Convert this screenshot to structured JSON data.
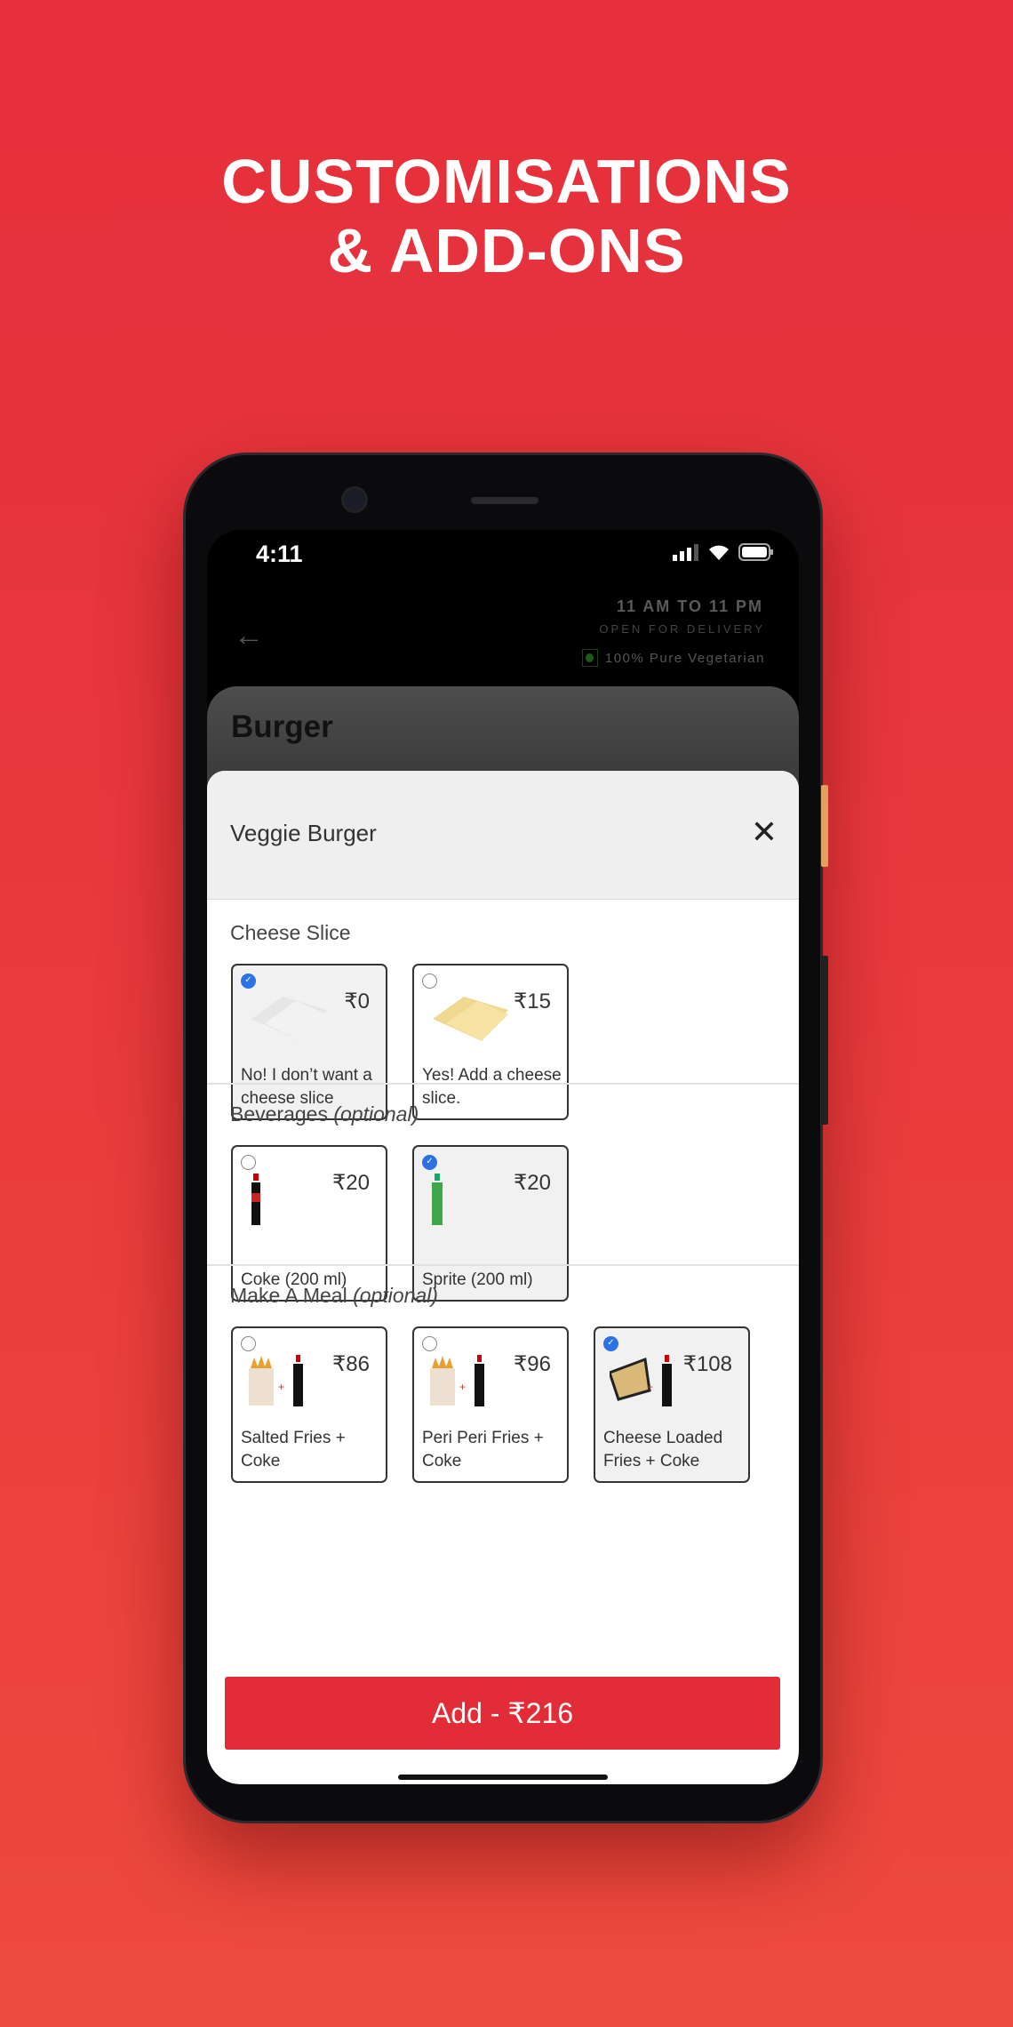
{
  "headline": {
    "line1": "CUSTOMISATIONS",
    "line2": "& ADD-ONS"
  },
  "status_bar": {
    "time": "4:11",
    "icons": [
      "signal-icon",
      "wifi-icon",
      "battery-icon"
    ]
  },
  "restaurant": {
    "hours": "11 AM TO 11 PM",
    "status": "OPEN FOR DELIVERY",
    "veg_label": "100% Pure Vegetarian"
  },
  "category": {
    "title": "Burger"
  },
  "sheet": {
    "title": "Veggie Burger",
    "sections": [
      {
        "label": "Cheese Slice",
        "optional": "",
        "options": [
          {
            "name": "No! I don’t want a cheese slice",
            "price": "₹0",
            "selected": true,
            "image": "plain-slice"
          },
          {
            "name": "Yes! Add a cheese slice.",
            "price": "₹15",
            "selected": false,
            "image": "cheese-slice"
          }
        ]
      },
      {
        "label": "Beverages",
        "optional": "(optional)",
        "options": [
          {
            "name": "Coke (200 ml)",
            "price": "₹20",
            "selected": false,
            "image": "coke-bottle"
          },
          {
            "name": "Sprite (200 ml)",
            "price": "₹20",
            "selected": true,
            "image": "sprite-bottle"
          }
        ]
      },
      {
        "label": "Make A Meal",
        "optional": "(optional)",
        "options": [
          {
            "name": "Salted Fries + Coke",
            "price": "₹86",
            "selected": false,
            "image": "fries-coke"
          },
          {
            "name": "Peri Peri Fries + Coke",
            "price": "₹96",
            "selected": false,
            "image": "fries-coke"
          },
          {
            "name": "Cheese Loaded Fries + Coke",
            "price": "₹108",
            "selected": true,
            "image": "loaded-fries-coke"
          }
        ]
      }
    ],
    "add_button": "Add - ₹216"
  },
  "colors": {
    "accent": "#e22c38",
    "selected_radio": "#2a72e6",
    "background": "#e93a3d"
  }
}
